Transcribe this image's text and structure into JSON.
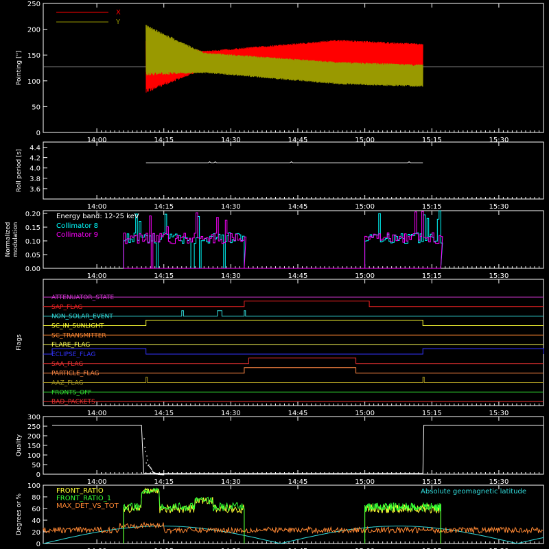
{
  "chart_data": [
    {
      "type": "line",
      "ylabel": "Pointing [\"]",
      "ylim": [
        0,
        250
      ],
      "yticks": [
        0,
        50,
        100,
        150,
        200,
        250
      ],
      "xlim": [
        13.8,
        15.6667
      ],
      "xticks": [
        "14:00",
        "14:15",
        "14:30",
        "14:45",
        "15:00",
        "15:15",
        "15:30"
      ],
      "legend_position": "top-left",
      "series": [
        {
          "name": "X",
          "color": "#ff0000",
          "active_range": [
            "14:11",
            "15:13"
          ],
          "center": [
            [
              14.18,
              130
            ],
            [
              14.4,
              140
            ],
            [
              14.9,
              152
            ],
            [
              15.22,
              150
            ]
          ],
          "amplitude": [
            [
              14.18,
              55
            ],
            [
              14.4,
              18
            ],
            [
              14.9,
              28
            ],
            [
              15.22,
              22
            ]
          ]
        },
        {
          "name": "Y",
          "color": "#999900",
          "active_range": [
            "14:11",
            "15:13"
          ],
          "center": [
            [
              14.18,
              160
            ],
            [
              14.4,
              135
            ],
            [
              14.9,
              115
            ],
            [
              15.22,
              110
            ]
          ],
          "amplitude": [
            [
              14.18,
              50
            ],
            [
              14.4,
              20
            ],
            [
              14.9,
              22
            ],
            [
              15.22,
              22
            ]
          ]
        }
      ],
      "baseline_value": 127
    },
    {
      "type": "line",
      "ylabel": "Roll period [s]",
      "ylim": [
        3.4,
        4.5
      ],
      "yticks": [
        3.6,
        3.8,
        4.0,
        4.2,
        4.4
      ],
      "yticklabels": [
        "3.6",
        "3.8",
        "4.0",
        "4.2",
        "4.4"
      ],
      "series": [
        {
          "name": "",
          "color": "#ffffff",
          "value": 4.1
        }
      ]
    },
    {
      "type": "bar",
      "ylabel": "Normalized modulation",
      "ylim": [
        0,
        0.21
      ],
      "yticks": [
        0,
        0.05,
        0.1,
        0.15,
        0.2
      ],
      "yticklabels": [
        "0.00",
        "0.05",
        "0.10",
        "0.15",
        "0.20"
      ],
      "annotation": "Energy band: 12-25 keV",
      "series": [
        {
          "name": "Collimator 8",
          "color": "#00ffff"
        },
        {
          "name": "Collimator 9",
          "color": "#ff00ff"
        }
      ],
      "active_intervals": [
        [
          "14:06",
          "14:33"
        ],
        [
          "15:00",
          "15:17"
        ]
      ]
    },
    {
      "type": "table",
      "ylabel": "Flags",
      "flags": [
        {
          "name": "ATTENUATOR_STATE",
          "color": "#cc33cc",
          "on": []
        },
        {
          "name": "SAP_FLAG",
          "color": "#ee2222",
          "on": [
            [
              "14:33",
              "15:01"
            ]
          ]
        },
        {
          "name": "NON_SOLAR_EVENT",
          "color": "#33dddd",
          "on": [
            [
              "14:19",
              "14:19.4"
            ],
            [
              "14:27",
              "14:28"
            ],
            [
              "14:33",
              "14:33.3"
            ]
          ]
        },
        {
          "name": "SC_IN_SUNLIGHT",
          "color": "#ffff33",
          "on": [
            [
              "14:11",
              "15:13"
            ]
          ]
        },
        {
          "name": "SC_TRANSMITTER",
          "color": "#ff8833",
          "on": []
        },
        {
          "name": "FLARE_FLAG",
          "color": "#ffff55",
          "on": []
        },
        {
          "name": "ECLIPSE_FLAG",
          "color": "#3333ff",
          "on": [
            [
              "13:50",
              "14:11"
            ],
            [
              "15:13",
              "15:40"
            ]
          ]
        },
        {
          "name": "SAA_FLAG",
          "color": "#ee3333",
          "on": [
            [
              "14:34",
              "14:58"
            ]
          ]
        },
        {
          "name": "PARTICLE_FLAG",
          "color": "#ff8844",
          "on": [
            [
              "14:33",
              "14:58"
            ]
          ]
        },
        {
          "name": "AAZ_FLAG",
          "color": "#aa9922",
          "on": [
            [
              "14:11",
              "14:11.3"
            ],
            [
              "15:13",
              "15:13.3"
            ]
          ]
        },
        {
          "name": "FRONTS_OFF",
          "color": "#33dd33",
          "on": []
        },
        {
          "name": "BAD_PACKETS",
          "color": "#ee3333",
          "on": []
        }
      ]
    },
    {
      "type": "line",
      "ylabel": "Quality",
      "ylim": [
        0,
        300
      ],
      "yticks": [
        0,
        50,
        100,
        150,
        200,
        250,
        300
      ],
      "series": [
        {
          "name": "",
          "color": "#ffffff",
          "points": [
            [
              "13:50",
              255
            ],
            [
              "14:10",
              255
            ],
            [
              "14:10.5",
              5
            ],
            [
              "15:13",
              5
            ],
            [
              "15:13.2",
              255
            ],
            [
              "15:40",
              255
            ]
          ]
        }
      ]
    },
    {
      "type": "line",
      "ylabel": "Degrees or %",
      "ylim": [
        0,
        100
      ],
      "yticks": [
        0,
        20,
        40,
        60,
        80,
        100
      ],
      "annotation": "Absolute geomagnetic latitude",
      "annotation_color": "#33dddd",
      "series": [
        {
          "name": "FRONT_RATIO",
          "color": "#ffff33"
        },
        {
          "name": "FRONT_RATIO_1",
          "color": "#33ff33"
        },
        {
          "name": "MAX_DET_VS_TOT",
          "color": "#ff8833"
        }
      ],
      "latitude_curve": {
        "color": "#33dddd",
        "min": 0,
        "max": 30
      }
    }
  ]
}
